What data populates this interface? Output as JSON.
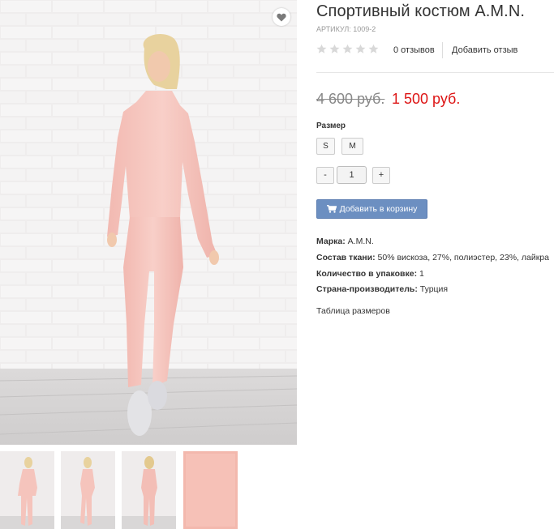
{
  "product": {
    "title": "Спортивный костюм A.M.N.",
    "sku_label": "Артикул:",
    "sku_value": "1009-2",
    "rating": 0,
    "rating_max": 5,
    "reviews_count": "0 отзывов",
    "add_review": "Добавить отзыв",
    "price_old": "4 600 руб.",
    "price_new": "1 500 руб."
  },
  "size": {
    "label": "Размер",
    "options": [
      "S",
      "M"
    ]
  },
  "quantity": {
    "minus": "-",
    "value": "1",
    "plus": "+"
  },
  "cart": {
    "label": "Добавить в корзину",
    "icon": "cart-icon"
  },
  "specs": [
    {
      "label": "Марка:",
      "value": "A.M.N."
    },
    {
      "label": "Состав ткани:",
      "value": "50% вискоза, 27%, полиэстер, 23%, лайкра"
    },
    {
      "label": "Количество в упаковке:",
      "value": "1"
    },
    {
      "label": "Страна-производитель:",
      "value": "Турция"
    }
  ],
  "size_table_link": "Таблица размеров",
  "gallery": {
    "favorite_icon": "heart-icon",
    "thumbnails": [
      "thumbnail-front",
      "thumbnail-side",
      "thumbnail-back",
      "thumbnail-fabric"
    ]
  },
  "colors": {
    "price_new": "#dd1414",
    "cart_button": "#6c8fc1",
    "suit_pink": "#f6c7c0"
  }
}
